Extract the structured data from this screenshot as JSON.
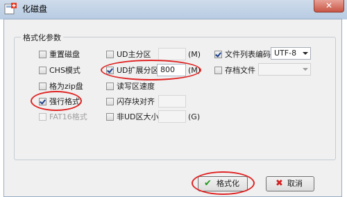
{
  "window": {
    "title": "化磁盘",
    "close_glyph": "✕"
  },
  "group": {
    "legend": "格式化参数"
  },
  "options": {
    "rewrite_disk": "重置磁盘",
    "chs_mode": "CHS模式",
    "zip_disk": "格为zip盘",
    "force_format": "强行格式",
    "fat16": "FAT16格式"
  },
  "partitions": {
    "ud_main": {
      "label": "UD主分区",
      "value": "",
      "unit": "(M)"
    },
    "ud_ext": {
      "label": "UD扩展分区",
      "value": "800",
      "unit": "(M)"
    },
    "read_speed": {
      "label": "读写区速度"
    },
    "flash_align": {
      "label": "闪存块对齐",
      "value": ""
    },
    "non_ud": {
      "label": "非UD区大小",
      "value": "",
      "unit": "(G)"
    }
  },
  "right": {
    "file_list_encoding": {
      "label": "文件列表编码",
      "selected": "UTF-8"
    },
    "archive_file": {
      "label": "存档文件",
      "selected": ""
    }
  },
  "buttons": {
    "format": {
      "label": "格式化",
      "glyph": "✔"
    },
    "cancel": {
      "label": "取消",
      "glyph": "✖"
    }
  },
  "colors": {
    "highlight_red": "#e02323",
    "check_green": "#1e9a1e",
    "cancel_red": "#d42020"
  }
}
